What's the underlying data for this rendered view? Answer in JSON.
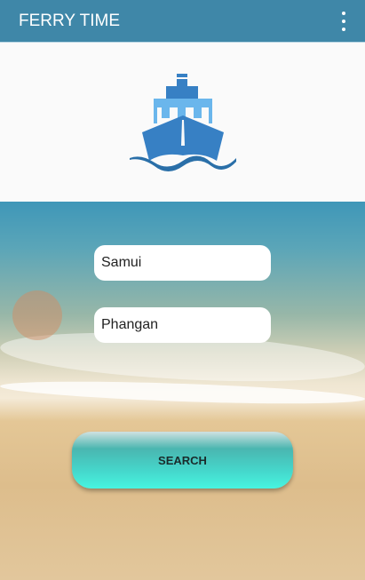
{
  "appbar": {
    "title": "FERRY TIME",
    "menu_icon": "more-vert-icon"
  },
  "banner": {
    "logo_icon": "ship-icon",
    "colors": {
      "dark": "#3780c4",
      "light": "#6ab6ec",
      "wave": "#2a6fa8"
    }
  },
  "form": {
    "from_value": "Samui",
    "to_value": "Phangan",
    "search_label": "SEARCH"
  },
  "colors": {
    "appbar": "#3f87a8"
  }
}
